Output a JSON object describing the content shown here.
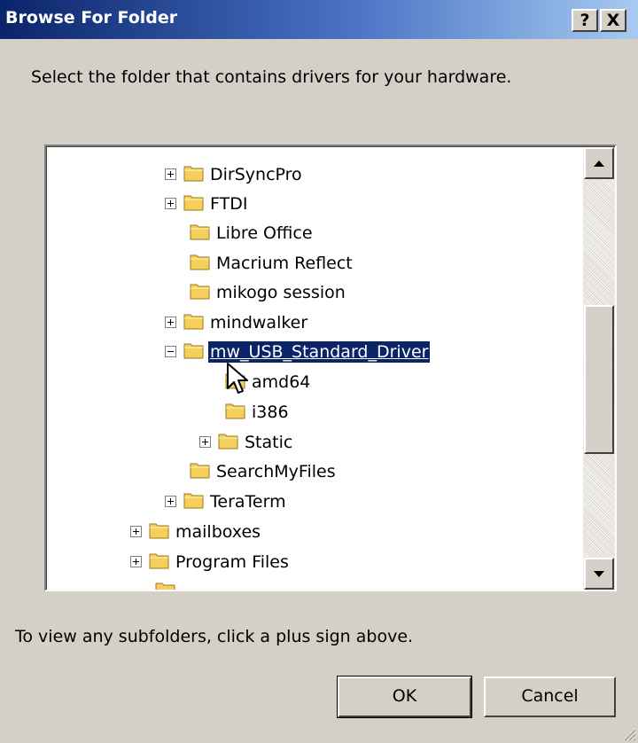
{
  "window": {
    "title": "Browse For Folder",
    "help_glyph": "?",
    "close_glyph": "X"
  },
  "instruction": "Select the folder that contains drivers for your hardware.",
  "tree": {
    "items": [
      {
        "label": "DirSyncPro",
        "expander": "plus"
      },
      {
        "label": "FTDI",
        "expander": "plus"
      },
      {
        "label": "Libre Office",
        "expander": "none"
      },
      {
        "label": "Macrium Reflect",
        "expander": "none"
      },
      {
        "label": "mikogo session",
        "expander": "none"
      },
      {
        "label": "mindwalker",
        "expander": "plus"
      },
      {
        "label": "mw_USB_Standard_Driver",
        "expander": "minus",
        "selected": true
      },
      {
        "label": "amd64",
        "expander": "none"
      },
      {
        "label": "i386",
        "expander": "none"
      },
      {
        "label": "Static",
        "expander": "plus"
      },
      {
        "label": "SearchMyFiles",
        "expander": "none"
      },
      {
        "label": "TeraTerm",
        "expander": "plus"
      },
      {
        "label": "mailboxes",
        "expander": "plus"
      },
      {
        "label": "Program Files",
        "expander": "plus"
      }
    ]
  },
  "hint": "To view any subfolders, click a plus sign above.",
  "buttons": {
    "ok": "OK",
    "cancel": "Cancel"
  },
  "colors": {
    "selection": "#0a246a",
    "title_bar": "#0a246a",
    "face": "#d4d0c8",
    "folder": "#f4cf5c"
  },
  "icons": [
    "folder-icon",
    "expand-plus-icon",
    "collapse-minus-icon",
    "scroll-up-arrow-icon",
    "scroll-down-arrow-icon",
    "resize-grip-icon",
    "mouse-cursor-icon"
  ]
}
